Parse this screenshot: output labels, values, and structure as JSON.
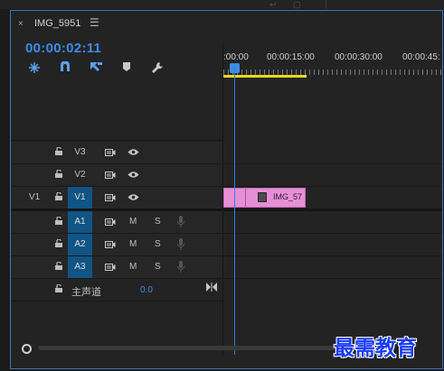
{
  "sequence_tab": {
    "close_glyph": "×",
    "title": "IMG_5951",
    "menu_glyph": "☰"
  },
  "timecode": "00:00:02:11",
  "toolbar": {
    "icons": [
      "snap-insert-icon",
      "magnet-snap-icon",
      "linked-selection-icon",
      "add-marker-icon",
      "wrench-settings-icon"
    ]
  },
  "ruler": {
    "labels": [
      ":00:00",
      "00:00:15:00",
      "00:00:30:00",
      "00:00:45:"
    ]
  },
  "video_tracks": [
    {
      "source": "",
      "name": "V3",
      "active": false
    },
    {
      "source": "",
      "name": "V2",
      "active": false
    },
    {
      "source": "V1",
      "name": "V1",
      "active": true
    }
  ],
  "audio_tracks": [
    {
      "name": "A1",
      "mute": "M",
      "solo": "S"
    },
    {
      "name": "A2",
      "mute": "M",
      "solo": "S"
    },
    {
      "name": "A3",
      "mute": "M",
      "solo": "S"
    }
  ],
  "clip": {
    "label": "IMG_57",
    "color": "#e78fd6"
  },
  "master": {
    "label": "主声道",
    "value": "0.0"
  },
  "watermark": "最需教育",
  "colors": {
    "accent": "#3d8de8",
    "workarea": "#e8d91b",
    "active_track": "#0f5585"
  }
}
